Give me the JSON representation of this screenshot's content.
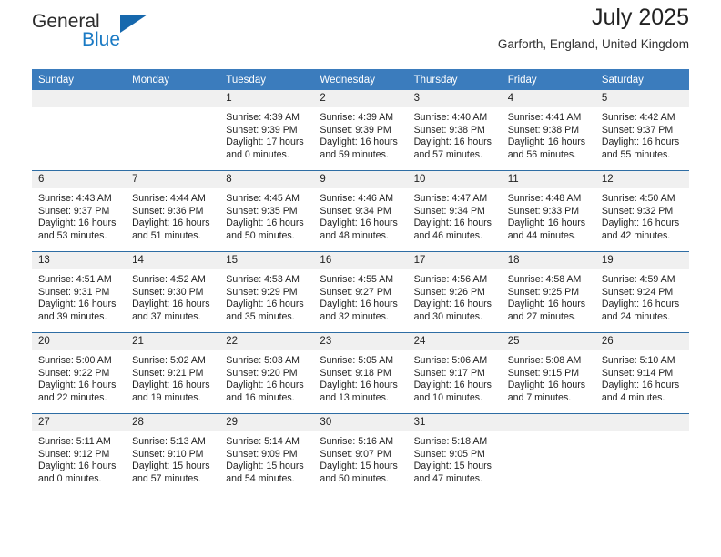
{
  "brand": {
    "name_part1": "General",
    "name_part2": "Blue",
    "triangle_color": "#1668ad",
    "blue_color": "#1a7ac4"
  },
  "header": {
    "title": "July 2025",
    "location": "Garforth, England, United Kingdom"
  },
  "colors": {
    "header_row_bg": "#3b7cbd",
    "daynum_bg": "#f0f0f0",
    "row_border": "#2e6da4",
    "text": "#222222"
  },
  "weekdays": [
    "Sunday",
    "Monday",
    "Tuesday",
    "Wednesday",
    "Thursday",
    "Friday",
    "Saturday"
  ],
  "weeks": [
    [
      {
        "day": "",
        "blank": true,
        "sunrise": "",
        "sunset": "",
        "daylight1": "",
        "daylight2": ""
      },
      {
        "day": "",
        "blank": true,
        "sunrise": "",
        "sunset": "",
        "daylight1": "",
        "daylight2": ""
      },
      {
        "day": "1",
        "sunrise": "Sunrise: 4:39 AM",
        "sunset": "Sunset: 9:39 PM",
        "daylight1": "Daylight: 17 hours",
        "daylight2": "and 0 minutes."
      },
      {
        "day": "2",
        "sunrise": "Sunrise: 4:39 AM",
        "sunset": "Sunset: 9:39 PM",
        "daylight1": "Daylight: 16 hours",
        "daylight2": "and 59 minutes."
      },
      {
        "day": "3",
        "sunrise": "Sunrise: 4:40 AM",
        "sunset": "Sunset: 9:38 PM",
        "daylight1": "Daylight: 16 hours",
        "daylight2": "and 57 minutes."
      },
      {
        "day": "4",
        "sunrise": "Sunrise: 4:41 AM",
        "sunset": "Sunset: 9:38 PM",
        "daylight1": "Daylight: 16 hours",
        "daylight2": "and 56 minutes."
      },
      {
        "day": "5",
        "sunrise": "Sunrise: 4:42 AM",
        "sunset": "Sunset: 9:37 PM",
        "daylight1": "Daylight: 16 hours",
        "daylight2": "and 55 minutes."
      }
    ],
    [
      {
        "day": "6",
        "sunrise": "Sunrise: 4:43 AM",
        "sunset": "Sunset: 9:37 PM",
        "daylight1": "Daylight: 16 hours",
        "daylight2": "and 53 minutes."
      },
      {
        "day": "7",
        "sunrise": "Sunrise: 4:44 AM",
        "sunset": "Sunset: 9:36 PM",
        "daylight1": "Daylight: 16 hours",
        "daylight2": "and 51 minutes."
      },
      {
        "day": "8",
        "sunrise": "Sunrise: 4:45 AM",
        "sunset": "Sunset: 9:35 PM",
        "daylight1": "Daylight: 16 hours",
        "daylight2": "and 50 minutes."
      },
      {
        "day": "9",
        "sunrise": "Sunrise: 4:46 AM",
        "sunset": "Sunset: 9:34 PM",
        "daylight1": "Daylight: 16 hours",
        "daylight2": "and 48 minutes."
      },
      {
        "day": "10",
        "sunrise": "Sunrise: 4:47 AM",
        "sunset": "Sunset: 9:34 PM",
        "daylight1": "Daylight: 16 hours",
        "daylight2": "and 46 minutes."
      },
      {
        "day": "11",
        "sunrise": "Sunrise: 4:48 AM",
        "sunset": "Sunset: 9:33 PM",
        "daylight1": "Daylight: 16 hours",
        "daylight2": "and 44 minutes."
      },
      {
        "day": "12",
        "sunrise": "Sunrise: 4:50 AM",
        "sunset": "Sunset: 9:32 PM",
        "daylight1": "Daylight: 16 hours",
        "daylight2": "and 42 minutes."
      }
    ],
    [
      {
        "day": "13",
        "sunrise": "Sunrise: 4:51 AM",
        "sunset": "Sunset: 9:31 PM",
        "daylight1": "Daylight: 16 hours",
        "daylight2": "and 39 minutes."
      },
      {
        "day": "14",
        "sunrise": "Sunrise: 4:52 AM",
        "sunset": "Sunset: 9:30 PM",
        "daylight1": "Daylight: 16 hours",
        "daylight2": "and 37 minutes."
      },
      {
        "day": "15",
        "sunrise": "Sunrise: 4:53 AM",
        "sunset": "Sunset: 9:29 PM",
        "daylight1": "Daylight: 16 hours",
        "daylight2": "and 35 minutes."
      },
      {
        "day": "16",
        "sunrise": "Sunrise: 4:55 AM",
        "sunset": "Sunset: 9:27 PM",
        "daylight1": "Daylight: 16 hours",
        "daylight2": "and 32 minutes."
      },
      {
        "day": "17",
        "sunrise": "Sunrise: 4:56 AM",
        "sunset": "Sunset: 9:26 PM",
        "daylight1": "Daylight: 16 hours",
        "daylight2": "and 30 minutes."
      },
      {
        "day": "18",
        "sunrise": "Sunrise: 4:58 AM",
        "sunset": "Sunset: 9:25 PM",
        "daylight1": "Daylight: 16 hours",
        "daylight2": "and 27 minutes."
      },
      {
        "day": "19",
        "sunrise": "Sunrise: 4:59 AM",
        "sunset": "Sunset: 9:24 PM",
        "daylight1": "Daylight: 16 hours",
        "daylight2": "and 24 minutes."
      }
    ],
    [
      {
        "day": "20",
        "sunrise": "Sunrise: 5:00 AM",
        "sunset": "Sunset: 9:22 PM",
        "daylight1": "Daylight: 16 hours",
        "daylight2": "and 22 minutes."
      },
      {
        "day": "21",
        "sunrise": "Sunrise: 5:02 AM",
        "sunset": "Sunset: 9:21 PM",
        "daylight1": "Daylight: 16 hours",
        "daylight2": "and 19 minutes."
      },
      {
        "day": "22",
        "sunrise": "Sunrise: 5:03 AM",
        "sunset": "Sunset: 9:20 PM",
        "daylight1": "Daylight: 16 hours",
        "daylight2": "and 16 minutes."
      },
      {
        "day": "23",
        "sunrise": "Sunrise: 5:05 AM",
        "sunset": "Sunset: 9:18 PM",
        "daylight1": "Daylight: 16 hours",
        "daylight2": "and 13 minutes."
      },
      {
        "day": "24",
        "sunrise": "Sunrise: 5:06 AM",
        "sunset": "Sunset: 9:17 PM",
        "daylight1": "Daylight: 16 hours",
        "daylight2": "and 10 minutes."
      },
      {
        "day": "25",
        "sunrise": "Sunrise: 5:08 AM",
        "sunset": "Sunset: 9:15 PM",
        "daylight1": "Daylight: 16 hours",
        "daylight2": "and 7 minutes."
      },
      {
        "day": "26",
        "sunrise": "Sunrise: 5:10 AM",
        "sunset": "Sunset: 9:14 PM",
        "daylight1": "Daylight: 16 hours",
        "daylight2": "and 4 minutes."
      }
    ],
    [
      {
        "day": "27",
        "sunrise": "Sunrise: 5:11 AM",
        "sunset": "Sunset: 9:12 PM",
        "daylight1": "Daylight: 16 hours",
        "daylight2": "and 0 minutes."
      },
      {
        "day": "28",
        "sunrise": "Sunrise: 5:13 AM",
        "sunset": "Sunset: 9:10 PM",
        "daylight1": "Daylight: 15 hours",
        "daylight2": "and 57 minutes."
      },
      {
        "day": "29",
        "sunrise": "Sunrise: 5:14 AM",
        "sunset": "Sunset: 9:09 PM",
        "daylight1": "Daylight: 15 hours",
        "daylight2": "and 54 minutes."
      },
      {
        "day": "30",
        "sunrise": "Sunrise: 5:16 AM",
        "sunset": "Sunset: 9:07 PM",
        "daylight1": "Daylight: 15 hours",
        "daylight2": "and 50 minutes."
      },
      {
        "day": "31",
        "sunrise": "Sunrise: 5:18 AM",
        "sunset": "Sunset: 9:05 PM",
        "daylight1": "Daylight: 15 hours",
        "daylight2": "and 47 minutes."
      },
      {
        "day": "",
        "blank": true,
        "sunrise": "",
        "sunset": "",
        "daylight1": "",
        "daylight2": ""
      },
      {
        "day": "",
        "blank": true,
        "sunrise": "",
        "sunset": "",
        "daylight1": "",
        "daylight2": ""
      }
    ]
  ]
}
